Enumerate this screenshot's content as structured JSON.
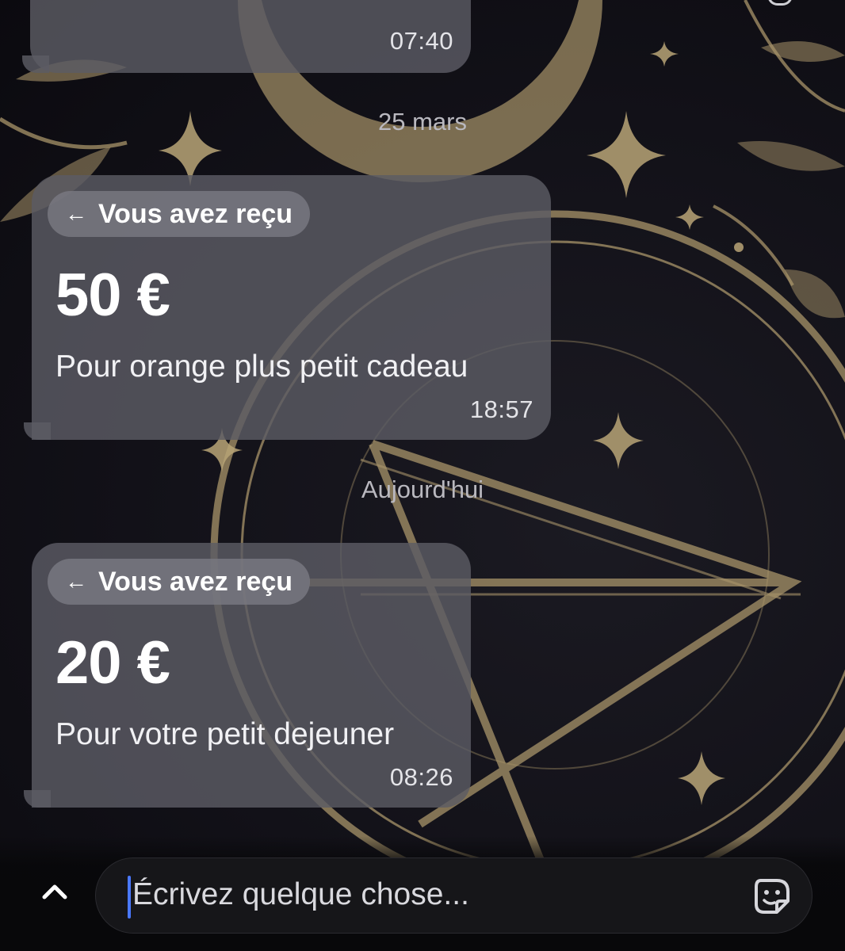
{
  "conversation": {
    "messages": [
      {
        "id": "msg-previous",
        "time": "07:40"
      },
      {
        "id": "msg-march",
        "date_separator": "25 mars",
        "chip_label": "Vous avez reçu",
        "amount": "50 €",
        "note": "Pour orange plus petit cadeau",
        "time": "18:57"
      },
      {
        "id": "msg-today",
        "date_separator": "Aujourd'hui",
        "chip_label": "Vous avez reçu",
        "amount": "20 €",
        "note": "Pour votre petit dejeuner",
        "time": "08:26"
      }
    ]
  },
  "composer": {
    "placeholder": "Écrivez quelque chose...",
    "expand_icon": "chevron-up-icon",
    "sticker_icon": "sticker-icon"
  },
  "colors": {
    "bubble": "#5c5c64",
    "chip": "#78787f",
    "caret": "#4a78ff",
    "wallpaper_gold": "#a8946a"
  }
}
